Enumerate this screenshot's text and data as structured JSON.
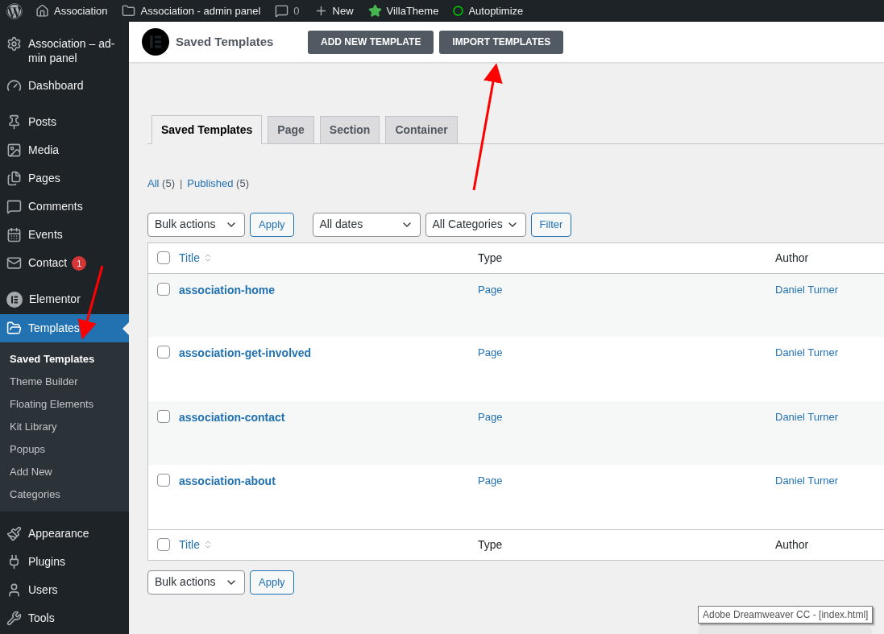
{
  "admin_bar": {
    "items": [
      "Association",
      "Association - admin panel",
      "0",
      "New",
      "VillaTheme",
      "Autoptimize"
    ]
  },
  "sidebar": {
    "groups": [
      [
        {
          "label": "Association – ad-min panel",
          "selected": false
        },
        {
          "label": "Dashboard",
          "selected": false
        }
      ],
      [
        {
          "label": "Posts",
          "selected": false
        },
        {
          "label": "Media",
          "selected": false
        },
        {
          "label": "Pages",
          "selected": false
        },
        {
          "label": "Comments",
          "selected": false
        },
        {
          "label": "Events",
          "selected": false
        },
        {
          "label": "Contact",
          "selected": false,
          "badge": "1"
        }
      ],
      [
        {
          "label": "Elementor",
          "selected": false
        },
        {
          "label": "Templates",
          "selected": true,
          "children": [
            {
              "label": "Saved Templates",
              "selected": true
            },
            {
              "label": "Theme Builder",
              "selected": false
            },
            {
              "label": "Floating Elements",
              "selected": false
            },
            {
              "label": "Kit Library",
              "selected": false
            },
            {
              "label": "Popups",
              "selected": false
            },
            {
              "label": "Add New",
              "selected": false
            },
            {
              "label": "Categories",
              "selected": false
            }
          ]
        }
      ],
      [
        {
          "label": "Appearance",
          "selected": false
        },
        {
          "label": "Plugins",
          "selected": false
        },
        {
          "label": "Users",
          "selected": false
        },
        {
          "label": "Tools",
          "selected": false
        }
      ]
    ]
  },
  "header": {
    "title": "Saved Templates",
    "buttons": [
      "ADD NEW TEMPLATE",
      "IMPORT TEMPLATES"
    ]
  },
  "tabs": [
    {
      "label": "Saved Templates",
      "selected": true
    },
    {
      "label": "Page",
      "selected": false
    },
    {
      "label": "Section",
      "selected": false
    },
    {
      "label": "Container",
      "selected": false
    }
  ],
  "status_links": [
    {
      "label": "All",
      "count": "(5)"
    },
    {
      "label": "Published",
      "count": "(5)"
    }
  ],
  "separator": "|",
  "filters": {
    "bulk_actions": "Bulk actions",
    "apply": "Apply",
    "dates": "All dates",
    "categories": "All Categories",
    "filter": "Filter"
  },
  "table": {
    "columns": [
      "Title",
      "Type",
      "Author"
    ],
    "header_checked": false,
    "footer_columns": [
      "Title",
      "Type",
      "Author"
    ],
    "footer_checked": false,
    "rows": [
      {
        "title": "association-home",
        "type": "Page",
        "author": "Daniel Turner",
        "checked": false
      },
      {
        "title": "association-get-involved",
        "type": "Page",
        "author": "Daniel Turner",
        "checked": false
      },
      {
        "title": "association-contact",
        "type": "Page",
        "author": "Daniel Turner",
        "checked": false
      },
      {
        "title": "association-about",
        "type": "Page",
        "author": "Daniel Turner",
        "checked": false
      }
    ]
  },
  "bottom_filters": {
    "bulk_actions": "Bulk actions",
    "apply": "Apply"
  },
  "tooltip": "Adobe Dreamweaver CC - [index.html]"
}
